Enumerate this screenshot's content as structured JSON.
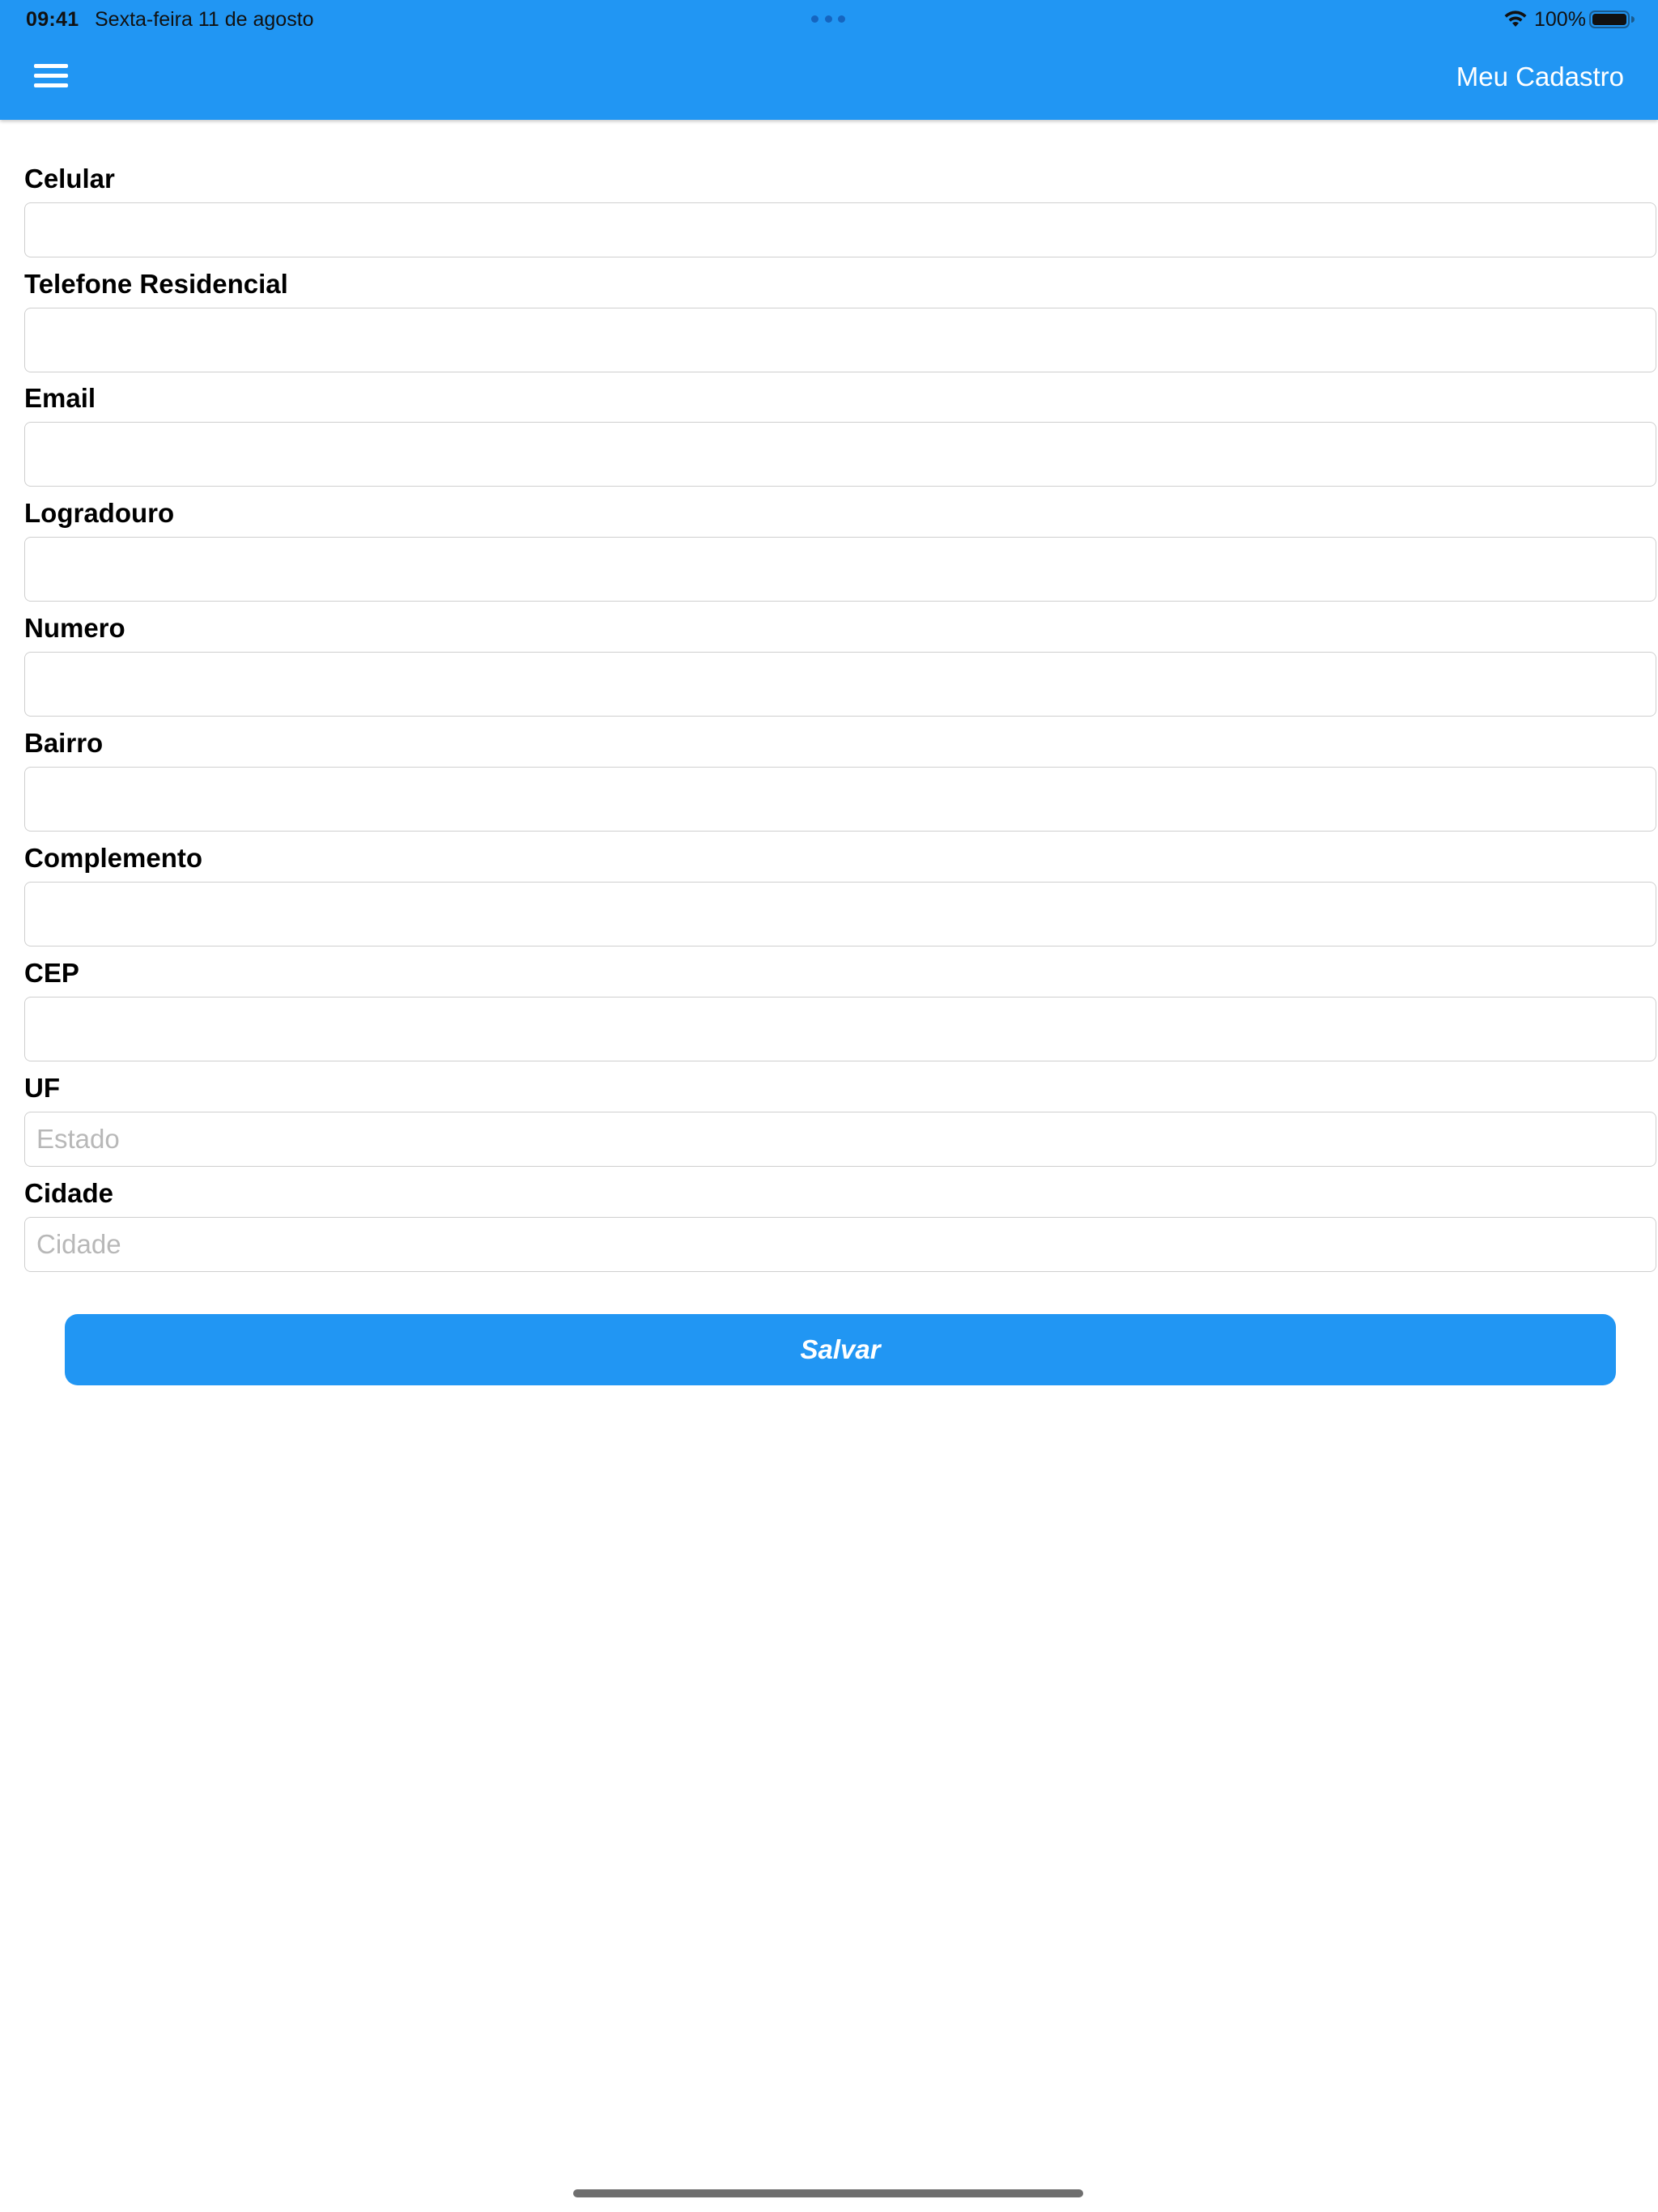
{
  "status_bar": {
    "time": "09:41",
    "date": "Sexta-feira 11 de agosto",
    "battery": "100%"
  },
  "header": {
    "title": "Meu Cadastro",
    "background": "#2196F3"
  },
  "form": {
    "fields": [
      {
        "label": "Celular",
        "value": "",
        "placeholder": ""
      },
      {
        "label": "Telefone Residencial",
        "value": "",
        "placeholder": ""
      },
      {
        "label": "Email",
        "value": "",
        "placeholder": ""
      },
      {
        "label": "Logradouro",
        "value": "",
        "placeholder": ""
      },
      {
        "label": "Numero",
        "value": "",
        "placeholder": ""
      },
      {
        "label": "Bairro",
        "value": "",
        "placeholder": ""
      },
      {
        "label": "Complemento",
        "value": "",
        "placeholder": ""
      },
      {
        "label": "CEP",
        "value": "",
        "placeholder": ""
      },
      {
        "label": "UF",
        "value": "",
        "placeholder": "Estado"
      },
      {
        "label": "Cidade",
        "value": "",
        "placeholder": "Cidade"
      }
    ],
    "save_label": "Salvar"
  },
  "icons": {
    "menu": "hamburger-menu-icon",
    "wifi": "wifi-icon",
    "battery": "battery-icon",
    "multitasking": "more-dots-icon"
  },
  "colors": {
    "primary": "#2196F3",
    "label": "#000000",
    "placeholder": "#B8B8B8",
    "input_border": "#CFCFCF"
  }
}
